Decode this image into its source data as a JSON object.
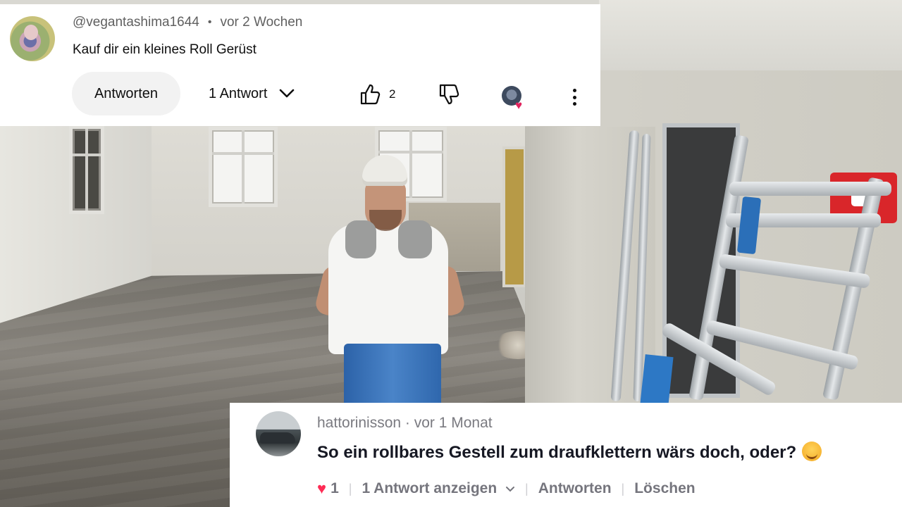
{
  "comment_top": {
    "platform": "YouTube",
    "username": "@vegantashima1644",
    "separator": "•",
    "time": "vor 2 Wochen",
    "text": "Kauf dir ein kleines Roll Gerüst",
    "reply_button": "Antworten",
    "replies_label": "1 Antwort",
    "like_count": "2",
    "icons": [
      "thumbs-up-icon",
      "thumbs-down-icon",
      "creator-heart-icon",
      "more-vertical-icon",
      "chevron-down-icon"
    ]
  },
  "comment_bottom": {
    "platform": "TikTok",
    "header": "hattorinisson · vor 1 Monat",
    "text": "So ein rollbares Gestell zum draufklettern wärs doch, oder?",
    "emoji": "😌",
    "like_count": "1",
    "view_replies": "1 Antwort anzeigen",
    "reply": "Antworten",
    "delete": "Löschen",
    "colors": {
      "heart": "#fe2c55",
      "meta": "#75757d"
    }
  }
}
